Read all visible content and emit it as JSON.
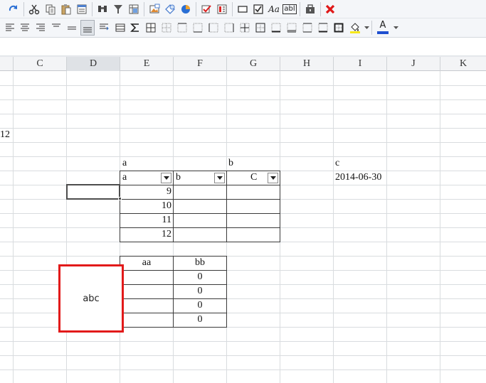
{
  "columns": [
    "C",
    "D",
    "E",
    "F",
    "G",
    "H",
    "I",
    "J",
    "K"
  ],
  "selected_column": "D",
  "cells": {
    "row_number_partial": "12",
    "header_a": "a",
    "header_b": "b",
    "header_c": "c",
    "filter_a": "a",
    "filter_b": "b",
    "filter_c": "C",
    "date_value": "2014-06-30",
    "num_rows": [
      "9",
      "10",
      "11",
      "12"
    ],
    "table2_header_aa": "aa",
    "table2_header_bb": "bb",
    "table2_values": [
      "0",
      "0",
      "0",
      "0"
    ]
  },
  "shape": {
    "label": "abc",
    "border_color": "#e21a1a"
  },
  "toolbar1": {
    "icons": [
      "redo-icon",
      "cut-icon",
      "copy-icon",
      "paste-icon",
      "form-icon",
      "find-icon",
      "filter-icon",
      "freeze-icon",
      "picture-icon",
      "shapes-icon",
      "chart-icon",
      "check-icon",
      "list-icon",
      "textbox-icon",
      "checkbox-icon",
      "label-icon",
      "textfield-icon",
      "toolbox-icon",
      "close-icon"
    ],
    "label_text": "Aa",
    "field_text": "abl"
  },
  "toolbar2": {
    "icons": [
      "align-left-icon",
      "align-center-icon",
      "align-right-icon",
      "justify-top-icon",
      "justify-middle-icon",
      "justify-bottom-icon",
      "wrap-icon",
      "merge-icon",
      "sum-icon",
      "borders-icon",
      "fill-color-icon",
      "font-color-icon"
    ],
    "font_color_letter": "A",
    "font_color": "#1f4fcf",
    "fill_color": "#f7e81b"
  }
}
